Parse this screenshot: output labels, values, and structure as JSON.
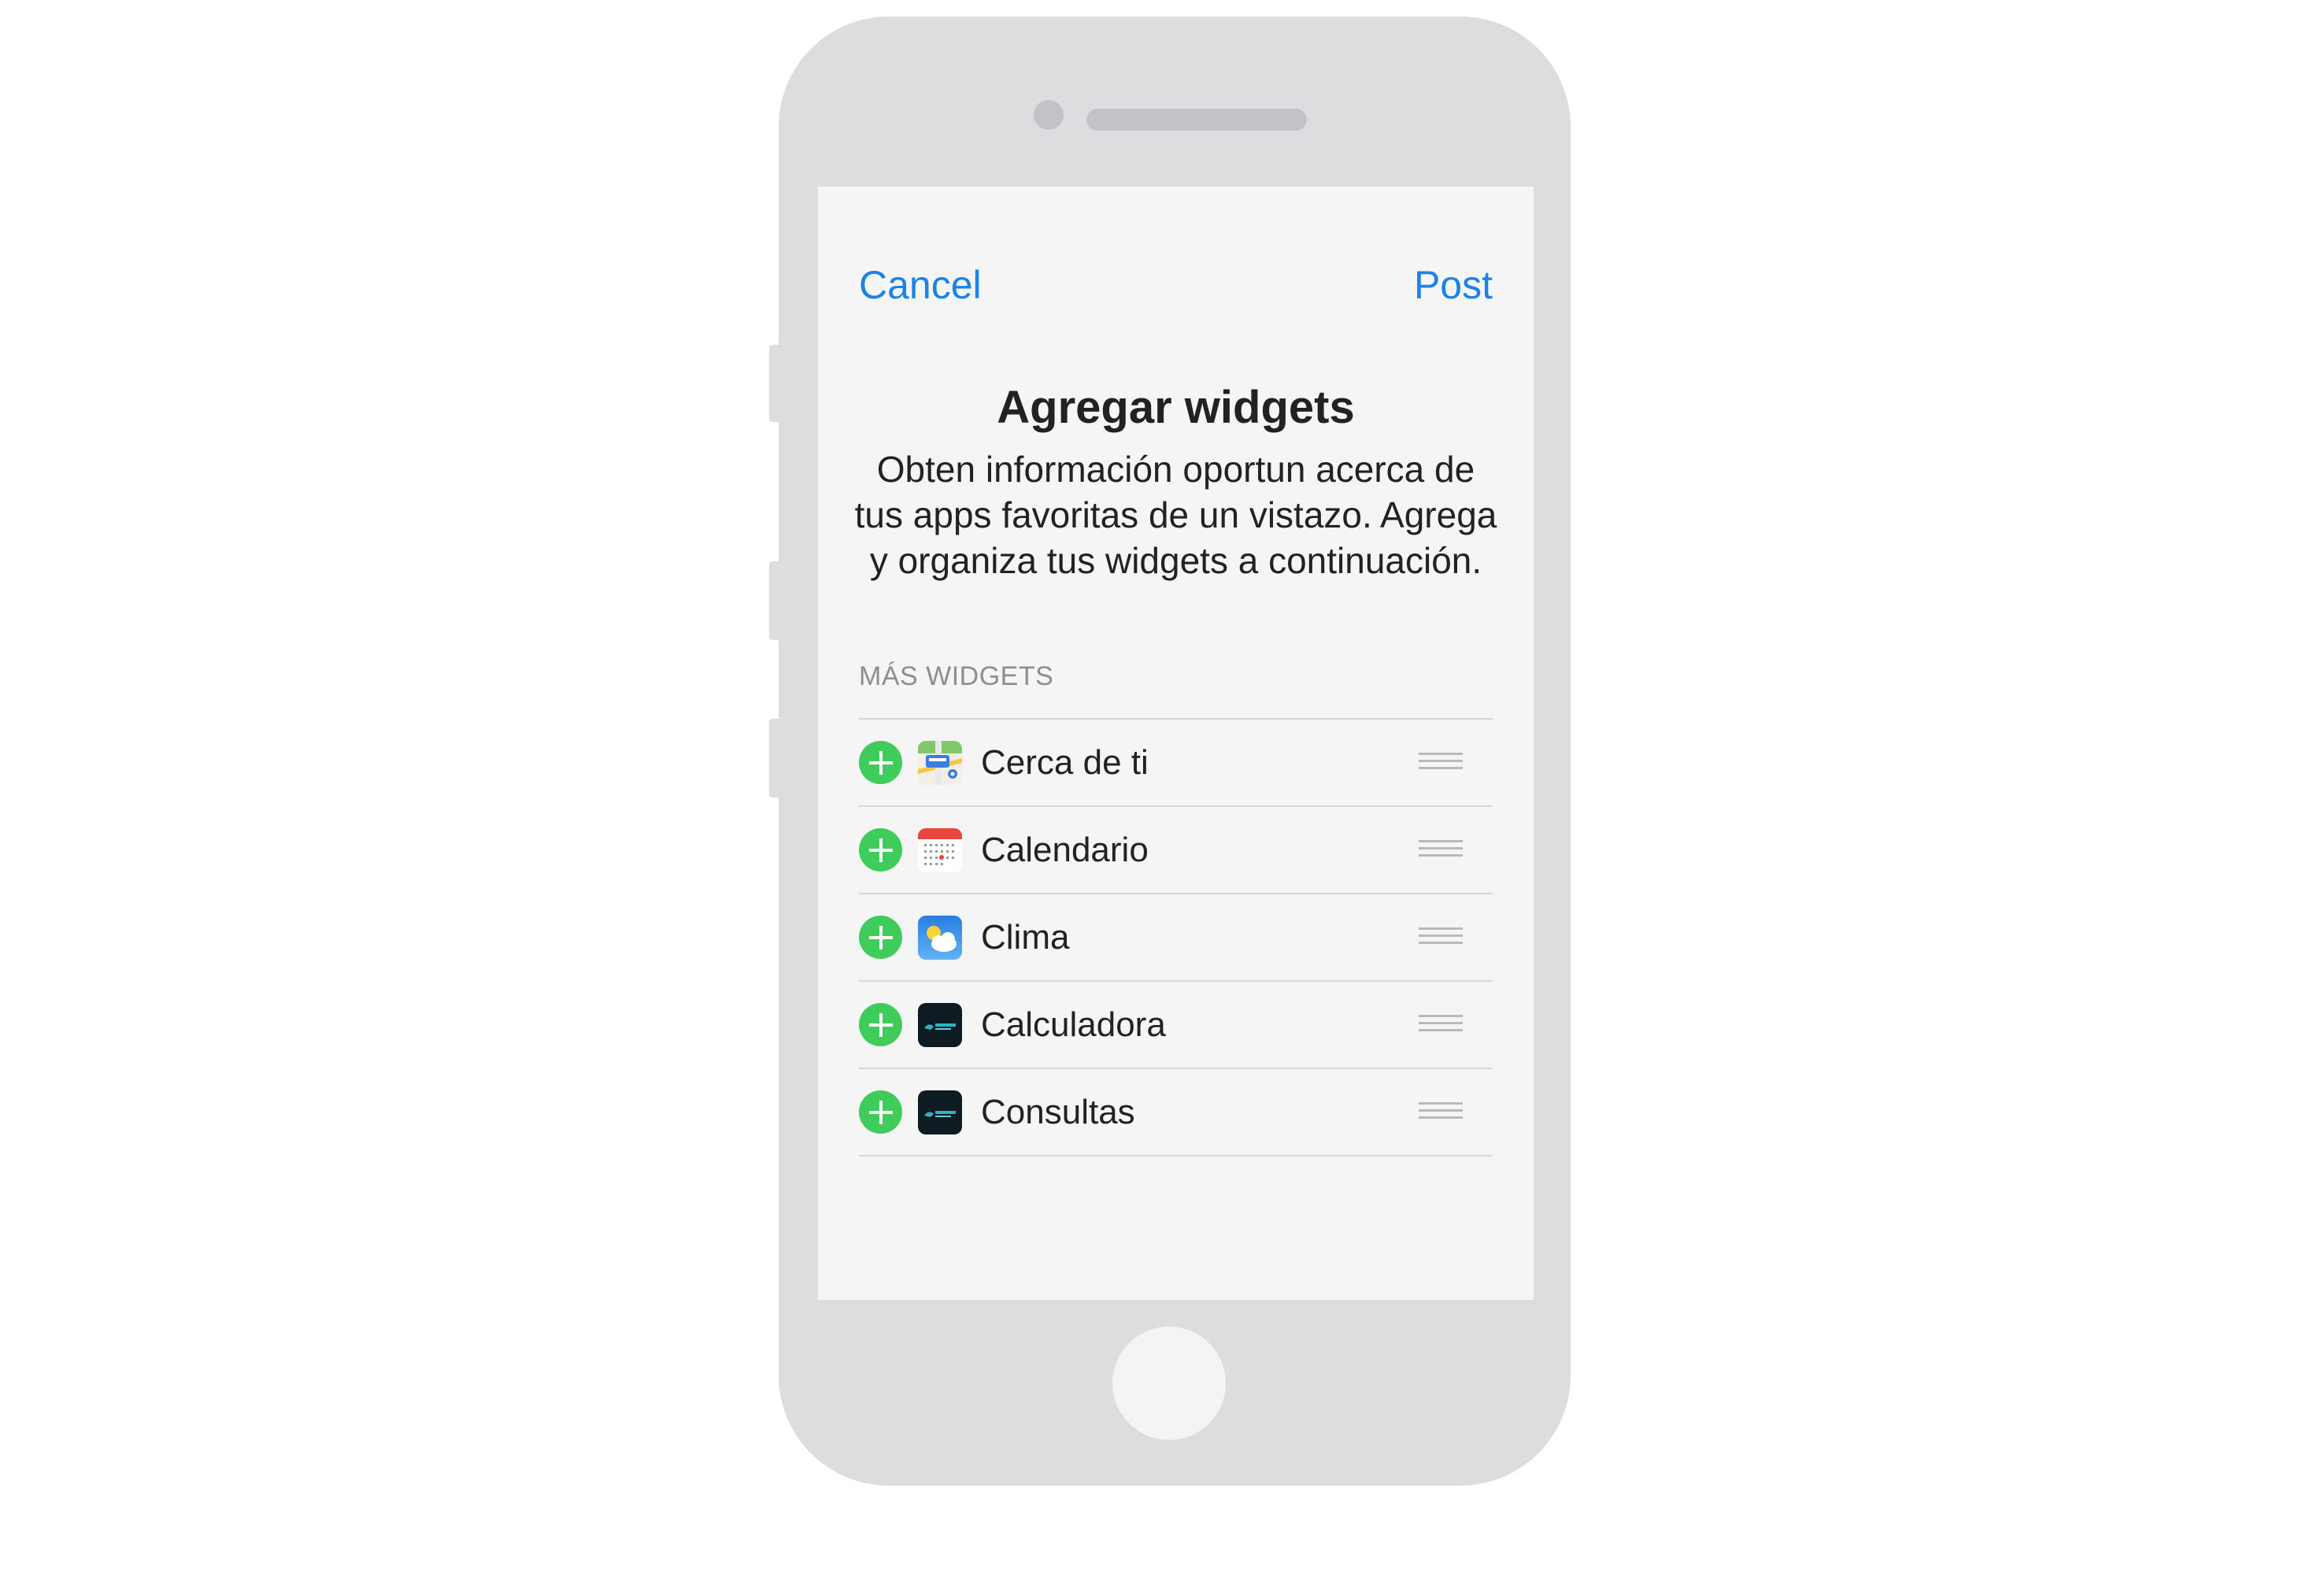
{
  "nav": {
    "cancel_label": "Cancel",
    "post_label": "Post"
  },
  "header": {
    "title": "Agregar widgets",
    "description": "Obten información oportun acerca de tus apps favoritas de un vistazo. Agrega y organiza tus widgets a continuación."
  },
  "section": {
    "title": "MÁS WIDGETS"
  },
  "widgets": [
    {
      "label": "Cerca de ti",
      "icon": "maps-icon"
    },
    {
      "label": "Calendario",
      "icon": "calendar-icon"
    },
    {
      "label": "Clima",
      "icon": "weather-icon"
    },
    {
      "label": "Calculadora",
      "icon": "calculator-app-icon"
    },
    {
      "label": "Consultas",
      "icon": "queries-app-icon"
    }
  ],
  "colors": {
    "accent": "#1a82e8",
    "add_button": "#3fcc5a",
    "phone_body": "#dcdddf",
    "screen_bg": "#f5f5f5"
  }
}
